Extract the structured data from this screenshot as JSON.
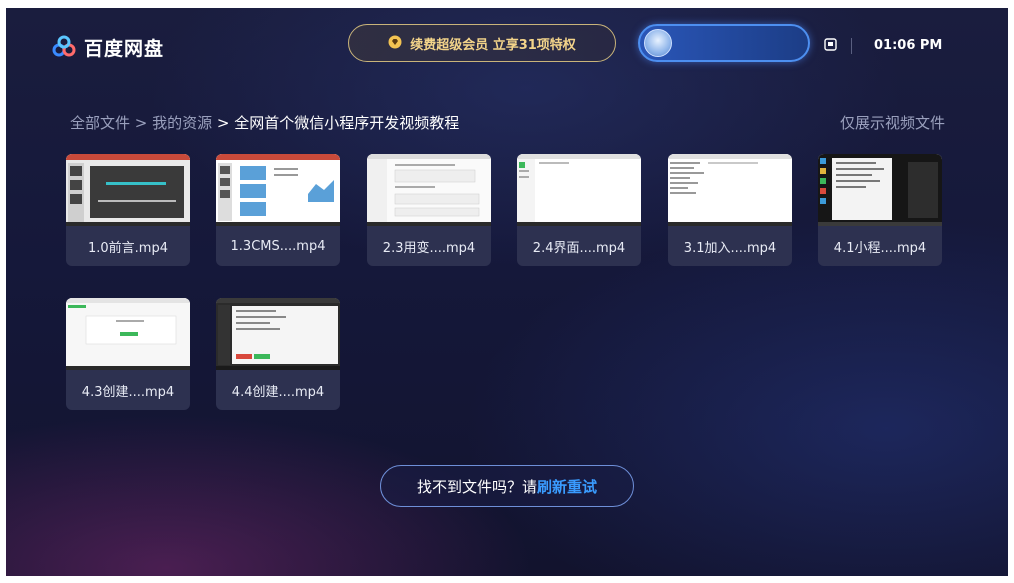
{
  "app": {
    "name": "百度网盘"
  },
  "header": {
    "vip_label": "续费超级会员 立享31项特权",
    "clock": "01:06 PM"
  },
  "breadcrumb": {
    "root": "全部文件",
    "sep": " > ",
    "level1": "我的资源",
    "current": "全网首个微信小程序开发视频教程"
  },
  "filter_label": "仅展示视频文件",
  "files": [
    {
      "name": "1.0前言.mp4",
      "thumb": "slide-dark"
    },
    {
      "name": "1.3CMS....mp4",
      "thumb": "slide-charts"
    },
    {
      "name": "2.3用变....mp4",
      "thumb": "code-editor"
    },
    {
      "name": "2.4界面....mp4",
      "thumb": "editor-green"
    },
    {
      "name": "3.1加入....mp4",
      "thumb": "code-list"
    },
    {
      "name": "4.1小程....mp4",
      "thumb": "desktop-dark"
    },
    {
      "name": "4.3创建....mp4",
      "thumb": "web-form"
    },
    {
      "name": "4.4创建....mp4",
      "thumb": "ide-dark"
    }
  ],
  "refresh": {
    "prefix": "找不到文件吗？请",
    "link": "刷新重试"
  },
  "colors": {
    "accent": "#3a9cff",
    "vip_gold": "#f3d48a",
    "pill_blue": "#2a56b8"
  }
}
